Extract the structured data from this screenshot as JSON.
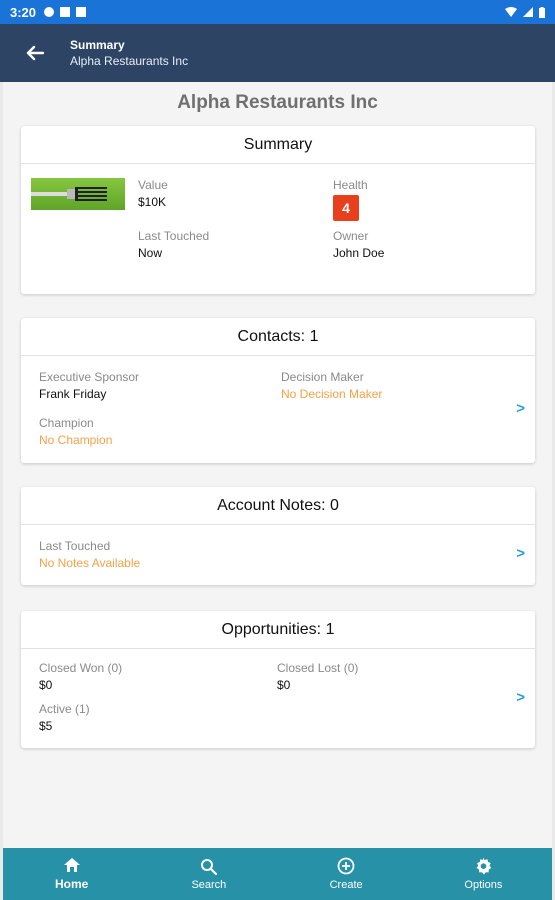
{
  "status_bar": {
    "time": "3:20"
  },
  "app_bar": {
    "title": "Summary",
    "subtitle": "Alpha Restaurants Inc"
  },
  "company_name": "Alpha Restaurants Inc",
  "summary": {
    "title": "Summary",
    "value_label": "Value",
    "value": "$10K",
    "health_label": "Health",
    "health": "4",
    "last_touched_label": "Last Touched",
    "last_touched": "Now",
    "owner_label": "Owner",
    "owner": "John Doe"
  },
  "contacts": {
    "title": "Contacts: 1",
    "exec_sponsor_label": "Executive Sponsor",
    "exec_sponsor": "Frank Friday",
    "decision_maker_label": "Decision Maker",
    "decision_maker": "No Decision Maker",
    "champion_label": "Champion",
    "champion": "No Champion"
  },
  "notes": {
    "title": "Account Notes: 0",
    "last_touched_label": "Last Touched",
    "last_touched": "No Notes Available"
  },
  "opportunities": {
    "title": "Opportunities: 1",
    "closed_won_label": "Closed Won (0)",
    "closed_won": "$0",
    "closed_lost_label": "Closed Lost (0)",
    "closed_lost": "$0",
    "active_label": "Active (1)",
    "active": "$5"
  },
  "nav": [
    {
      "label": "Home",
      "icon": "home-icon"
    },
    {
      "label": "Search",
      "icon": "search-icon"
    },
    {
      "label": "Create",
      "icon": "plus-circle-icon"
    },
    {
      "label": "Options",
      "icon": "gear-icon"
    }
  ],
  "colors": {
    "status_bar": "#1a73d6",
    "app_bar": "#2d4464",
    "nav_bar": "#2791a7",
    "warning_text": "#f5a146",
    "health_badge": "#e8401c",
    "chevron": "#2a9fd6"
  },
  "chevron_glyph": ">"
}
